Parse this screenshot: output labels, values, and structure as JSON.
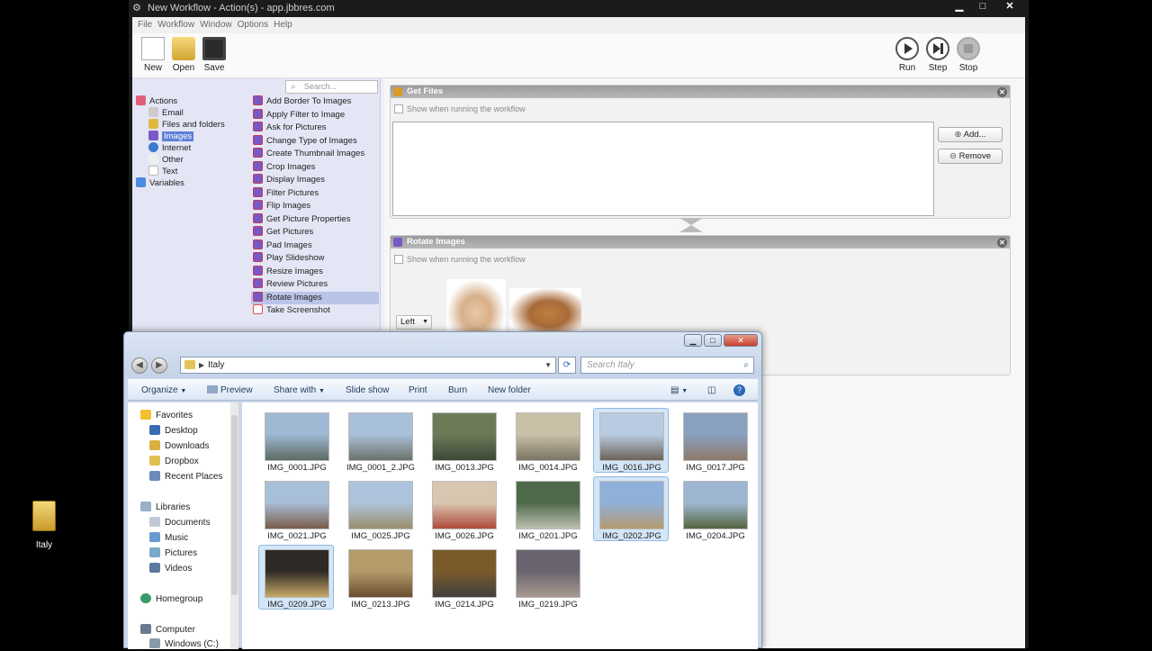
{
  "workflow_window": {
    "title": "New Workflow - Action(s) - app.jbbres.com",
    "menu": [
      "File",
      "Workflow",
      "Window",
      "Options",
      "Help"
    ],
    "toolbar_left": [
      "New",
      "Open",
      "Save"
    ],
    "toolbar_right": [
      "Run",
      "Step",
      "Stop"
    ],
    "search_placeholder": "Search...",
    "categories": [
      "Actions",
      "Email",
      "Files and folders",
      "Images",
      "Internet",
      "Other",
      "Text",
      "Variables"
    ],
    "selected_category": "Images",
    "actions": [
      "Add Border To Images",
      "Apply Filter to Image",
      "Ask for Pictures",
      "Change Type of Images",
      "Create Thumbnail Images",
      "Crop Images",
      "Display Images",
      "Filter Pictures",
      "Flip Images",
      "Get Picture Properties",
      "Get Pictures",
      "Pad Images",
      "Play Slideshow",
      "Resize Images",
      "Review Pictures",
      "Rotate Images",
      "Take Screenshot"
    ],
    "selected_action": "Rotate Images",
    "panel_get_files": {
      "title": "Get Files",
      "show_label": "Show when running the workflow",
      "add_button": "Add...",
      "remove_button": "Remove"
    },
    "panel_rotate": {
      "title": "Rotate Images",
      "show_label": "Show when running the workflow",
      "direction_value": "Left"
    }
  },
  "explorer": {
    "address": "Italy",
    "search_placeholder": "Search Italy",
    "commands": [
      "Organize",
      "Preview",
      "Share with",
      "Slide show",
      "Print",
      "Burn",
      "New folder"
    ],
    "nav": {
      "favorites_header": "Favorites",
      "favorites": [
        "Desktop",
        "Downloads",
        "Dropbox",
        "Recent Places"
      ],
      "libraries_header": "Libraries",
      "libraries": [
        "Documents",
        "Music",
        "Pictures",
        "Videos"
      ],
      "homegroup": "Homegroup",
      "computer": "Computer",
      "drive": "Windows (C:)"
    },
    "files": [
      {
        "name": "IMG_0001.JPG",
        "selected": false,
        "colors": [
          "#9fb8d4",
          "#5d6b64"
        ]
      },
      {
        "name": "IMG_0001_2.JPG",
        "selected": false,
        "colors": [
          "#a9c0da",
          "#6b7169"
        ]
      },
      {
        "name": "IMG_0013.JPG",
        "selected": false,
        "colors": [
          "#6d7a58",
          "#3d4736"
        ]
      },
      {
        "name": "IMG_0014.JPG",
        "selected": false,
        "colors": [
          "#c9c0a8",
          "#7b7565"
        ]
      },
      {
        "name": "IMG_0016.JPG",
        "selected": true,
        "colors": [
          "#b9cbe0",
          "#6b6459"
        ]
      },
      {
        "name": "IMG_0017.JPG",
        "selected": false,
        "colors": [
          "#8aa0c0",
          "#8d7a68"
        ]
      },
      {
        "name": "IMG_0021.JPG",
        "selected": false,
        "colors": [
          "#a8bfd8",
          "#7a5b48"
        ]
      },
      {
        "name": "IMG_0025.JPG",
        "selected": false,
        "colors": [
          "#aec4dc",
          "#9a8d6c"
        ]
      },
      {
        "name": "IMG_0026.JPG",
        "selected": false,
        "colors": [
          "#d9c6b0",
          "#b04a3a"
        ]
      },
      {
        "name": "IMG_0201.JPG",
        "selected": false,
        "colors": [
          "#4f6a4a",
          "#bcc0b0"
        ]
      },
      {
        "name": "IMG_0202.JPG",
        "selected": true,
        "colors": [
          "#8fb0d8",
          "#b49a70"
        ]
      },
      {
        "name": "IMG_0204.JPG",
        "selected": false,
        "colors": [
          "#9fb6d2",
          "#54663f"
        ]
      },
      {
        "name": "IMG_0209.JPG",
        "selected": true,
        "colors": [
          "#2e2a26",
          "#c9a868"
        ]
      },
      {
        "name": "IMG_0213.JPG",
        "selected": false,
        "colors": [
          "#b59a6a",
          "#6b4e2e"
        ]
      },
      {
        "name": "IMG_0214.JPG",
        "selected": false,
        "colors": [
          "#7a5a2a",
          "#404040"
        ]
      },
      {
        "name": "IMG_0219.JPG",
        "selected": false,
        "colors": [
          "#6b6470",
          "#a89a90"
        ]
      }
    ]
  },
  "desktop_icon": "Italy"
}
